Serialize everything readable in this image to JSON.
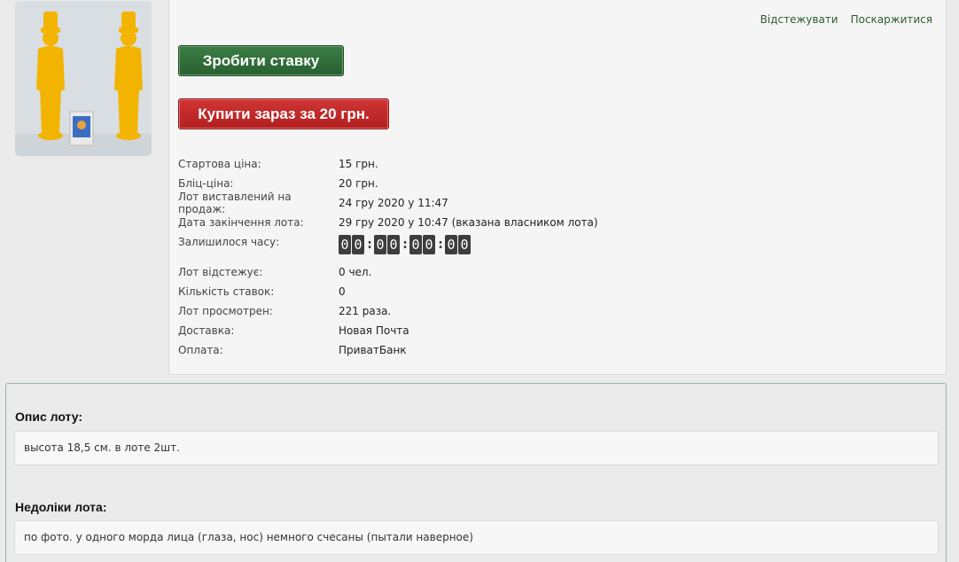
{
  "photo": {
    "alt": "yellow toy soldiers",
    "colors": {
      "toy": "#f2b400",
      "bg": "#d9dee2"
    }
  },
  "links": {
    "watch": "Відстежувати",
    "complain": "Поскаржитися"
  },
  "buttons": {
    "bid": "Зробити ставку",
    "buy_now": "Купити зараз за 20 грн."
  },
  "details": {
    "start_price": {
      "label": "Стартова ціна:",
      "value": "15 грн."
    },
    "blitz_price": {
      "label": "Бліц-ціна:",
      "value": "20 грн."
    },
    "listed": {
      "label": "Лот виставлений на продаж:",
      "value": "24 гру 2020 у 11:47"
    },
    "end_date": {
      "label": "Дата закінчення лота:",
      "value": "29 гру 2020 у 10:47 (вказана власником лота)"
    },
    "time_left": {
      "label": "Залишилося часу:",
      "digits": [
        "0",
        "0",
        "0",
        "0",
        "0",
        "0",
        "0",
        "0"
      ]
    },
    "watchers": {
      "label": "Лот відстежує:",
      "value": "0 чел."
    },
    "bids": {
      "label": "Кількість ставок:",
      "value": "0"
    },
    "views": {
      "label": "Лот просмотрен:",
      "value": "221 раза."
    },
    "delivery": {
      "label": "Доставка:",
      "value": "Новая Почта"
    },
    "payment": {
      "label": "Оплата:",
      "value": "ПриватБанк"
    }
  },
  "description": {
    "title": "Опис лоту:",
    "text": "высота 18,5 см. в лоте 2шт."
  },
  "defects": {
    "title": "Недоліки лота:",
    "text": "по фото. у одного морда лица (глаза, нос) немного счесаны (пытали наверное)"
  }
}
